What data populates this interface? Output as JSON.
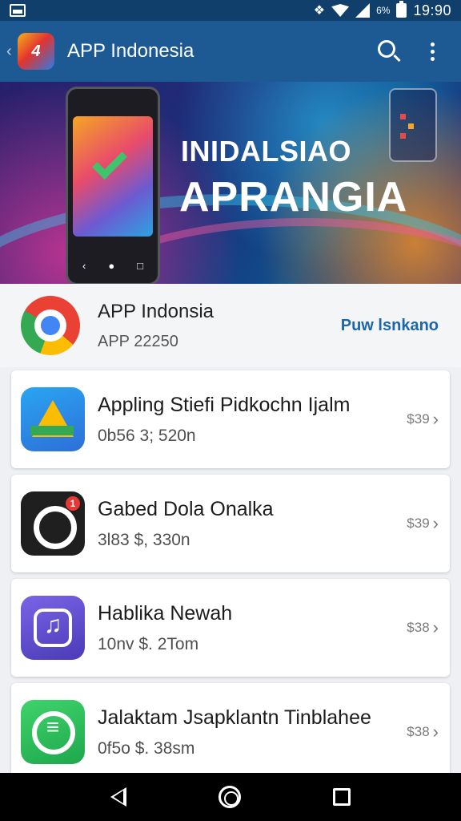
{
  "status_bar": {
    "network_label": "6%",
    "time": "19:90"
  },
  "app_bar": {
    "logo_text": "4",
    "title": "APP Indonesia",
    "search_icon": "search-icon",
    "more_icon": "more-vert-icon"
  },
  "banner": {
    "line1": "INIDALSIAO",
    "line2": "APRANGIA"
  },
  "featured": {
    "name": "APP Indonsia",
    "subtitle": "APP 22250",
    "action": "Puw lsnkano"
  },
  "apps": [
    {
      "title": "Appling Stiefi Pidkochn Ijalm",
      "subtitle": "0b56 3; 520n",
      "price": "$39",
      "icon": "drive-icon"
    },
    {
      "title": "Gabed Dola Onalka",
      "subtitle": "3l83 $, 330n",
      "price": "$39",
      "icon": "chat-icon"
    },
    {
      "title": "Hablika Newah",
      "subtitle": "10nv $. 2Tom",
      "price": "$38",
      "icon": "music-icon"
    },
    {
      "title": "Jalaktam Jsapklantn Tinblahee",
      "subtitle": "0f5o $. 38sm",
      "price": "$38",
      "icon": "whatsapp-icon"
    }
  ],
  "nav": {
    "back": "back-icon",
    "home": "home-icon",
    "recents": "recents-icon"
  }
}
